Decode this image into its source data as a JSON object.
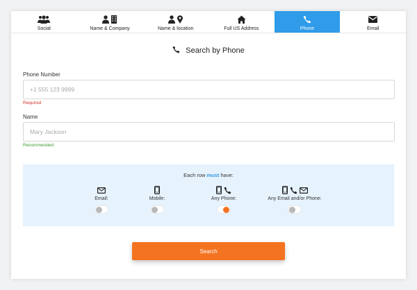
{
  "tabs": [
    {
      "label": "Social",
      "icon": "users-icon",
      "active": false
    },
    {
      "label": "Name & Company",
      "icon": "person-building-icon",
      "active": false
    },
    {
      "label": "Name & location",
      "icon": "person-pin-icon",
      "active": false
    },
    {
      "label": "Full US Address",
      "icon": "home-icon",
      "active": false
    },
    {
      "label": "Phone",
      "icon": "phone-icon",
      "active": true
    },
    {
      "label": "Email",
      "icon": "envelope-icon",
      "active": false
    }
  ],
  "heading": {
    "title": "Search by Phone",
    "icon": "phone-icon"
  },
  "phone_field": {
    "label": "Phone Number",
    "placeholder": "+1 555 123 9999",
    "value": "",
    "hint": "Required"
  },
  "name_field": {
    "label": "Name",
    "placeholder": "Mary Jackson",
    "value": "",
    "hint": "Recommended"
  },
  "rules": {
    "title_prefix": "Each row ",
    "title_emphasis": "must",
    "title_suffix": " have:",
    "options": [
      {
        "label": "Email:",
        "enabled": false
      },
      {
        "label": "Mobile:",
        "enabled": false
      },
      {
        "label": "Any Phone:",
        "enabled": true
      },
      {
        "label": "Any Email and/or Phone:",
        "enabled": false
      }
    ]
  },
  "search_button": {
    "label": "Search"
  },
  "colors": {
    "accent_blue": "#2f9be9",
    "accent_orange": "#f47321",
    "required_red": "#d0342c",
    "recommended_green": "#3c9a2e",
    "rules_bg": "#e6f2fc"
  }
}
